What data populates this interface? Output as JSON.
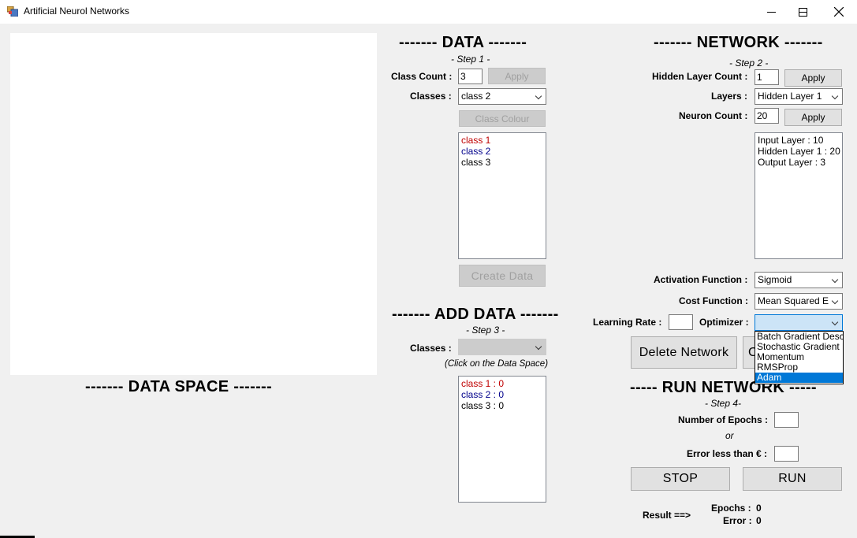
{
  "window": {
    "title": "Artificial Neurol Networks",
    "minimize": "—",
    "maximize": "☐",
    "close": "✕"
  },
  "data_space": {
    "heading": "------- DATA SPACE -------"
  },
  "data": {
    "heading": "------- DATA -------",
    "step": "- Step 1 -",
    "class_count_label": "Class Count :",
    "class_count_value": "3",
    "apply_label": "Apply",
    "classes_label": "Classes :",
    "classes_selected": "class 2",
    "class_colour_label": "Class Colour",
    "class_list": [
      {
        "label": "class 1",
        "color": "#c00000"
      },
      {
        "label": "class 2",
        "color": "#00008b"
      },
      {
        "label": "class 3",
        "color": "#000000"
      }
    ],
    "create_data_label": "Create Data"
  },
  "add_data": {
    "heading": "------- ADD DATA -------",
    "step": "- Step 3 -",
    "classes_label": "Classes :",
    "classes_selected": "",
    "hint": "(Click on the Data Space)",
    "counts": [
      {
        "label": "class 1 : 0",
        "color": "#c00000"
      },
      {
        "label": "class 2 : 0",
        "color": "#00008b"
      },
      {
        "label": "class 3 : 0",
        "color": "#000000"
      }
    ]
  },
  "network": {
    "heading": "------- NETWORK -------",
    "step": "- Step 2 -",
    "hidden_layer_count_label": "Hidden Layer Count :",
    "hidden_layer_count_value": "1",
    "apply_label": "Apply",
    "layers_label": "Layers :",
    "layers_selected": "Hidden Layer 1",
    "neuron_count_label": "Neuron Count :",
    "neuron_count_value": "20",
    "layer_list": [
      "Input Layer : 10",
      "Hidden Layer 1 : 20",
      "Output Layer : 3"
    ],
    "activation_label": "Activation Function :",
    "activation_selected": "Sigmoid",
    "cost_label": "Cost Function :",
    "cost_selected": "Mean Squared Error",
    "learning_rate_label": "Learning Rate :",
    "learning_rate_value": "",
    "optimizer_label": "Optimizer :",
    "optimizer_selected": "",
    "optimizer_options": [
      "Batch Gradient Descent",
      "Stochastic Gradient Descent",
      "Momentum",
      "RMSProp",
      "Adam"
    ],
    "optimizer_highlighted": "Adam",
    "delete_network_label": "Delete  Network",
    "hidden_button_partial": "C"
  },
  "run": {
    "heading": "----- RUN NETWORK -----",
    "step": "- Step 4-",
    "epochs_label": "Number of Epochs :",
    "epochs_value": "",
    "or_label": "or",
    "error_label": "Error less than € :",
    "error_value": "",
    "stop_label": "STOP",
    "run_label": "RUN",
    "result_label": "Result ==>",
    "epochs_result_label": "Epochs :",
    "epochs_result_value": "0",
    "error_result_label": "Error :",
    "error_result_value": "0"
  }
}
